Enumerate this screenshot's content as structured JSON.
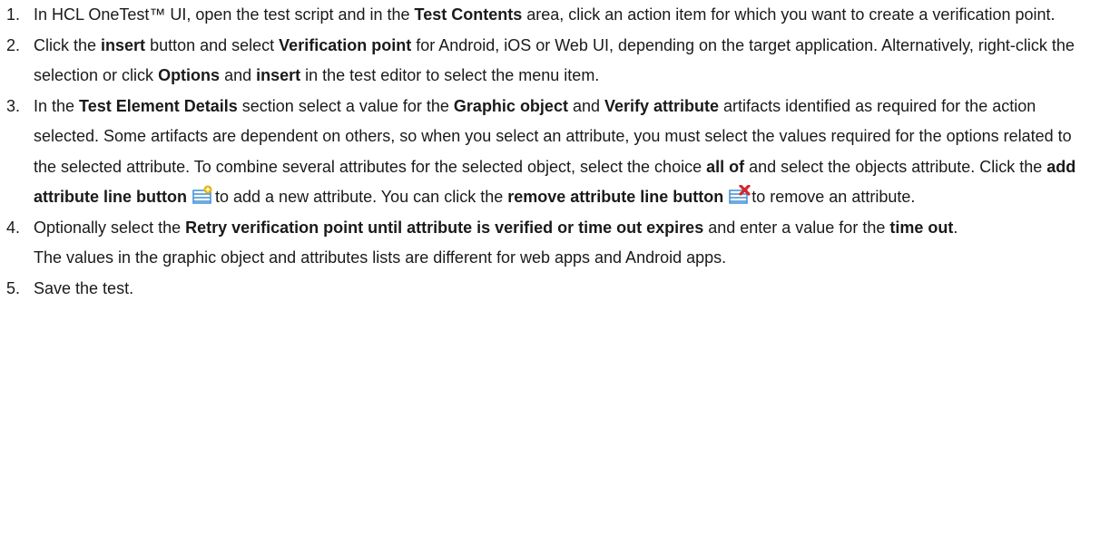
{
  "steps": [
    {
      "num": "1.",
      "parts": [
        {
          "t": "In HCL OneTest™ UI, open the test script and in the "
        },
        {
          "b": "Test Contents"
        },
        {
          "t": " area, click an action item for which you want to create a verification point."
        }
      ]
    },
    {
      "num": "2.",
      "parts": [
        {
          "t": "Click the "
        },
        {
          "b": "insert"
        },
        {
          "t": " button and select "
        },
        {
          "b": "Verification point"
        },
        {
          "t": " for Android, iOS or Web UI, depending on the target application. Alternatively, right-click the selection or click "
        },
        {
          "b": "Options"
        },
        {
          "t": " and "
        },
        {
          "b": "insert"
        },
        {
          "t": " in the test editor to select the menu item."
        }
      ]
    },
    {
      "num": "3.",
      "parts": [
        {
          "t": "In the "
        },
        {
          "b": "Test Element Details"
        },
        {
          "t": " section select a value for the "
        },
        {
          "b": "Graphic object"
        },
        {
          "t": " and "
        },
        {
          "b": "Verify attribute"
        },
        {
          "t": " artifacts identified as required for the action selected. Some artifacts are dependent on others, so when you select an attribute, you must select the values required for the options related to the selected attribute. To combine several attributes for the selected object, select the choice "
        },
        {
          "b": "all of"
        },
        {
          "t": " and select the objects attribute. Click the "
        },
        {
          "b": "add attribute line button"
        },
        {
          "t": " "
        },
        {
          "icon": "add-attribute-line-icon"
        },
        {
          "t": "to add a new attribute. You can click the "
        },
        {
          "b": "remove attribute line button"
        },
        {
          "t": " "
        },
        {
          "icon": "remove-attribute-line-icon"
        },
        {
          "t": "to remove an attribute."
        }
      ]
    },
    {
      "num": "4.",
      "parts": [
        {
          "t": "Optionally select the "
        },
        {
          "b": "Retry verification point until attribute is verified or time out expires"
        },
        {
          "t": " and enter a value for the "
        },
        {
          "b": "time out"
        },
        {
          "t": "."
        }
      ],
      "note": "The values in the graphic object and attributes lists are different for web apps and Android apps."
    },
    {
      "num": "5.",
      "parts": [
        {
          "t": "Save the test."
        }
      ]
    }
  ],
  "icons": {
    "add-attribute-line-icon": {
      "accent": "#e8b400",
      "body": "#3d8fd6"
    },
    "remove-attribute-line-icon": {
      "accent": "#d7262a",
      "body": "#3d8fd6"
    }
  }
}
